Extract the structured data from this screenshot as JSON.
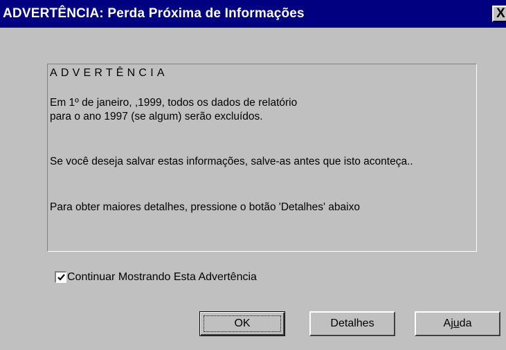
{
  "window": {
    "title": "ADVERTÊNCIA: Perda Próxima de Informações",
    "close_glyph": "X"
  },
  "message": {
    "heading": "ADVERTÊNCIA",
    "line1": "Em 1º de janeiro, ,1999, todos os dados de relatório",
    "line2": "para o ano 1997 (se algum) serão excluídos.",
    "line3": "Se você deseja salvar estas informações, salve-as antes que isto aconteça..",
    "line4": "Para obter maiores detalhes, pressione o botão 'Detalhes' abaixo"
  },
  "checkbox": {
    "label": "Continuar Mostrando Esta Advertência",
    "checked": true
  },
  "buttons": {
    "ok": "OK",
    "details": "Detalhes",
    "help_prefix": "Aj",
    "help_mnemonic": "u",
    "help_suffix": "da"
  },
  "colors": {
    "titlebar": "#000080",
    "face": "#c0c0c0"
  },
  "icons": {
    "close": "close-icon",
    "check": "checkmark-icon"
  }
}
